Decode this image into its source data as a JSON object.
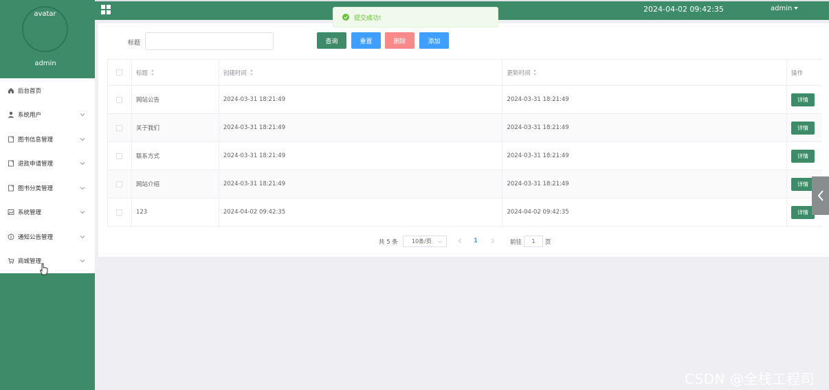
{
  "profile": {
    "avatar_text": "avatar",
    "name": "admin"
  },
  "menu": {
    "items": [
      {
        "label": "后台首页",
        "icon": "home-icon",
        "has_children": false
      },
      {
        "label": "系统用户",
        "icon": "user-icon",
        "has_children": true
      },
      {
        "label": "图书信息管理",
        "icon": "document-icon",
        "has_children": true
      },
      {
        "label": "退款申请管理",
        "icon": "document-icon",
        "has_children": true
      },
      {
        "label": "图书分类管理",
        "icon": "document-icon",
        "has_children": true
      },
      {
        "label": "系统管理",
        "icon": "picture-icon",
        "has_children": true
      },
      {
        "label": "通知公告管理",
        "icon": "info-icon",
        "has_children": true
      },
      {
        "label": "商城管理",
        "icon": "cart-icon",
        "has_children": true
      }
    ]
  },
  "topbar": {
    "title": "",
    "datetime": "2024-04-02 09:42:35",
    "user": "admin"
  },
  "toast": {
    "message": "提交成功!",
    "type": "success"
  },
  "search": {
    "label": "标题",
    "value": "",
    "placeholder": "",
    "buttons": {
      "query": "查询",
      "reset": "重置",
      "delete": "删除",
      "add": "添加"
    }
  },
  "table": {
    "headers": {
      "title": "标题",
      "created": "创建时间",
      "updated": "更新时间",
      "actions": "操作"
    },
    "rows": [
      {
        "title": "网站公告",
        "created": "2024-03-31 18:21:49",
        "updated": "2024-03-31 18:21:49",
        "action": "详情"
      },
      {
        "title": "关于我们",
        "created": "2024-03-31 18:21:49",
        "updated": "2024-03-31 18:21:49",
        "action": "详情"
      },
      {
        "title": "联系方式",
        "created": "2024-03-31 18:21:49",
        "updated": "2024-03-31 18:21:49",
        "action": "详情"
      },
      {
        "title": "网站介绍",
        "created": "2024-03-31 18:21:49",
        "updated": "2024-03-31 18:21:49",
        "action": "详情"
      },
      {
        "title": "123",
        "created": "2024-04-02 09:42:35",
        "updated": "2024-04-02 09:42:35",
        "action": "详情"
      }
    ]
  },
  "pagination": {
    "total": "共 5 条",
    "page_size": "10条/页",
    "current_page": "1",
    "goto_label": "前往",
    "goto_value": "1",
    "goto_unit": "页"
  },
  "watermark": "CSDN @全栈工程司",
  "colors": {
    "primary": "#3d8b68",
    "blue": "#409eff",
    "danger": "#f78989",
    "success": "#67c23a"
  }
}
